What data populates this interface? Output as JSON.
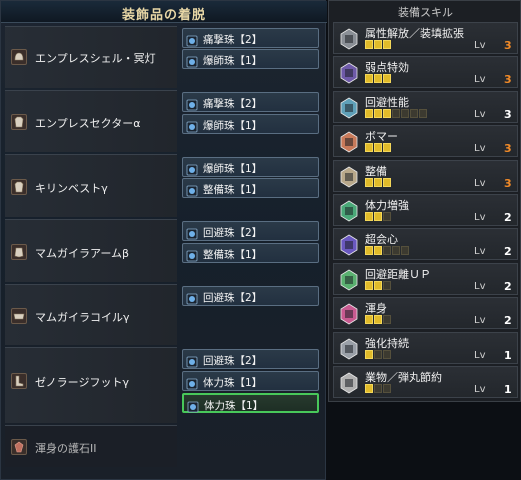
{
  "left_panel": {
    "title": "装飾品の着脱",
    "armor": [
      {
        "name": "エンプレスシェル・冥灯",
        "icon": "helm-icon",
        "decorations": [
          "痛撃珠【2】",
          "爆師珠【1】"
        ]
      },
      {
        "name": "エンプレスセクターα",
        "icon": "chest-icon",
        "decorations": [
          "痛撃珠【2】",
          "爆師珠【1】"
        ]
      },
      {
        "name": "キリンベストγ",
        "icon": "chest-icon",
        "decorations": [
          "爆師珠【1】",
          "整備珠【1】"
        ]
      },
      {
        "name": "マムガイラアームβ",
        "icon": "arm-icon",
        "decorations": [
          "回避珠【2】",
          "整備珠【1】"
        ]
      },
      {
        "name": "マムガイラコイルγ",
        "icon": "waist-icon",
        "decorations": [
          "回避珠【2】"
        ]
      },
      {
        "name": "ゼノラージフットγ",
        "icon": "leg-icon",
        "decorations": [
          "回避珠【2】",
          "体力珠【1】",
          "体力珠【1】"
        ]
      }
    ],
    "charm": {
      "name": "渾身の護石II",
      "icon": "charm-icon"
    },
    "selected_slot_color": "#48c85a"
  },
  "right_panel": {
    "title": "装備スキル",
    "level_label": "Lv",
    "skills": [
      {
        "name": "属性解放／装填拡張",
        "level": 3,
        "max": 3,
        "icon_color": "#8a8f96",
        "maxed": true
      },
      {
        "name": "弱点特効",
        "level": 3,
        "max": 3,
        "icon_color": "#6e5aa8",
        "maxed": true
      },
      {
        "name": "回避性能",
        "level": 3,
        "max": 7,
        "icon_color": "#5fa0b8",
        "maxed": false
      },
      {
        "name": "ボマー",
        "level": 3,
        "max": 3,
        "icon_color": "#c87a5a",
        "maxed": true
      },
      {
        "name": "整備",
        "level": 3,
        "max": 3,
        "icon_color": "#b8a88a",
        "maxed": true
      },
      {
        "name": "体力増強",
        "level": 2,
        "max": 3,
        "icon_color": "#4aa878",
        "maxed": false
      },
      {
        "name": "超会心",
        "level": 2,
        "max": 5,
        "icon_color": "#6a58c0",
        "maxed": false
      },
      {
        "name": "回避距離ＵＰ",
        "level": 2,
        "max": 3,
        "icon_color": "#5ab070",
        "maxed": false
      },
      {
        "name": "渾身",
        "level": 2,
        "max": 3,
        "icon_color": "#c85a90",
        "maxed": false
      },
      {
        "name": "強化持続",
        "level": 1,
        "max": 3,
        "icon_color": "#9aa0a8",
        "maxed": false
      },
      {
        "name": "業物／弾丸節約",
        "level": 1,
        "max": 3,
        "icon_color": "#b0b0b0",
        "maxed": false
      }
    ]
  },
  "colors": {
    "pip_on": "#e1bb2a",
    "max_level": "#f08a28",
    "slot_border": "#5a6e82"
  }
}
